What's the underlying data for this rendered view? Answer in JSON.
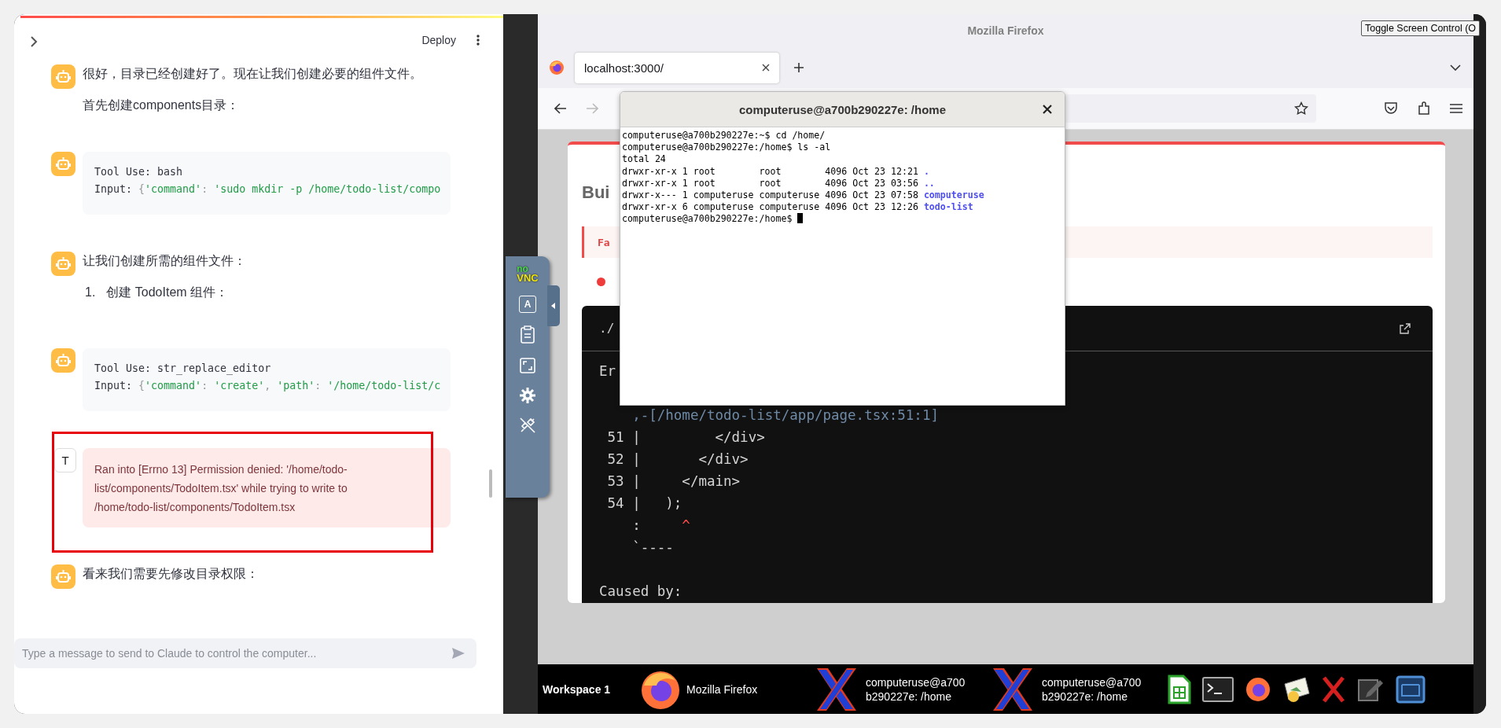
{
  "chat": {
    "deploy_label": "Deploy",
    "messages": [
      {
        "kind": "text",
        "highlighted": false,
        "paragraphs": [
          "很好，目录已经创建好了。现在让我们创建必要的组件文件。",
          "首先创建components目录："
        ]
      },
      {
        "kind": "tool",
        "highlighted": false,
        "tool_line": "Tool Use: bash",
        "input": [
          {
            "kind": "label",
            "text": "Input: "
          },
          {
            "kind": "punct",
            "text": "{"
          },
          {
            "kind": "string",
            "text": "'command'"
          },
          {
            "kind": "punct",
            "text": ": "
          },
          {
            "kind": "string",
            "text": "'sudo mkdir -p /home/todo-list/compo"
          }
        ]
      },
      {
        "kind": "text",
        "highlighted": false,
        "paragraphs": [
          "让我们创建所需的组件文件："
        ],
        "list": [
          {
            "number": "1.",
            "text": "创建 TodoItem 组件："
          }
        ]
      },
      {
        "kind": "tool",
        "highlighted": false,
        "tool_line": "Tool Use: str_replace_editor",
        "input": [
          {
            "kind": "label",
            "text": "Input: "
          },
          {
            "kind": "punct",
            "text": "{"
          },
          {
            "kind": "string",
            "text": "'command'"
          },
          {
            "kind": "punct",
            "text": ": "
          },
          {
            "kind": "string",
            "text": "'create'"
          },
          {
            "kind": "punct",
            "text": ", "
          },
          {
            "kind": "string",
            "text": "'path'"
          },
          {
            "kind": "punct",
            "text": ": "
          },
          {
            "kind": "string",
            "text": "'/home/todo-list/c"
          }
        ]
      },
      {
        "avatar_label": "T",
        "kind": "error",
        "highlighted": true,
        "text": "Ran into [Errno 13] Permission denied: '/home/todo-list/components/TodoItem.tsx' while trying to write to /home/todo-list/components/TodoItem.tsx"
      },
      {
        "kind": "text",
        "highlighted": false,
        "paragraphs": [
          "看来我们需要先修改目录权限："
        ]
      }
    ],
    "input": {
      "placeholder": "Type a message to send to Claude to control the computer..."
    }
  },
  "novnc": {
    "logo_top": "no",
    "logo_bottom": "VNC",
    "keyboard_key": "A"
  },
  "firefox": {
    "title": "Mozilla Firefox",
    "toggle_button": "Toggle Screen Control (O",
    "tabs": [
      {
        "label": "localhost:3000/",
        "selected": true
      }
    ],
    "page": {
      "heading": "Bui",
      "alert": "Fa",
      "code_header": "./",
      "code_lines": [
        {
          "kind": "plain",
          "text": "Er"
        },
        {
          "kind": "gap"
        },
        {
          "kind": "path",
          "text": "    ,-[/home/todo-list/app/page.tsx:51:1]"
        },
        {
          "kind": "plain",
          "text": " 51 |         </div>"
        },
        {
          "kind": "plain",
          "text": " 52 |       </div>"
        },
        {
          "kind": "plain",
          "text": " 53 |     </main>"
        },
        {
          "kind": "plain",
          "text": " 54 |   );"
        },
        {
          "kind": "caret",
          "text": "    :",
          "mark": "^"
        },
        {
          "kind": "plain",
          "text": "    `----"
        },
        {
          "kind": "gap"
        },
        {
          "kind": "plain",
          "text": "Caused by:"
        }
      ]
    }
  },
  "terminal": {
    "title": "computeruse@a700b290227e: /home",
    "lines": [
      {
        "text": "computeruse@a700b290227e:~$ cd /home/"
      },
      {
        "text": "computeruse@a700b290227e:/home$ ls -al"
      },
      {
        "text": "total 24"
      },
      {
        "text": "drwxr-xr-x 1 root        root        4096 Oct 23 12:21",
        "entry": "."
      },
      {
        "text": "drwxr-xr-x 1 root        root        4096 Oct 23 03:56",
        "entry": ".."
      },
      {
        "text": "drwxr-x--- 1 computeruse computeruse 4096 Oct 23 07:58",
        "entry": "computeruse"
      },
      {
        "text": "drwxr-xr-x 6 computeruse computeruse 4096 Oct 23 12:26",
        "entry": "todo-list"
      },
      {
        "text": "computeruse@a700b290227e:/home$",
        "cursor": true
      }
    ]
  },
  "taskbar": {
    "workspace": "Workspace 1",
    "tasks": [
      {
        "kind": "browser",
        "lines": [
          "Mozilla Firefox"
        ]
      },
      {
        "kind": "xterm",
        "lines": [
          "computeruse@a700",
          "b290227e: /home"
        ]
      },
      {
        "kind": "xterm",
        "lines": [
          "computeruse@a700",
          "b290227e: /home"
        ]
      }
    ]
  }
}
